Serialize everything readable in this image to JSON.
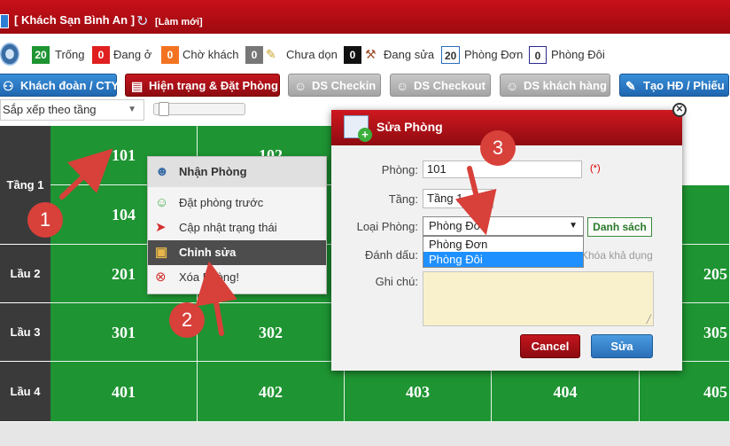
{
  "header": {
    "hotel_name": "[ Khách Sạn Bình An ]",
    "refresh_label": "[Làm mới]"
  },
  "status_counts": [
    {
      "count": "20",
      "label": "Trống",
      "color": "#1e9432",
      "text_color": "#ffffff"
    },
    {
      "count": "0",
      "label": "Đang ở",
      "color": "#e02020",
      "text_color": "#ffffff"
    },
    {
      "count": "0",
      "label": "Chờ khách",
      "color": "#f47321",
      "text_color": "#ffffff"
    },
    {
      "count": "0",
      "label": "Chưa dọn",
      "color": "#777777",
      "text_color": "#ffffff"
    },
    {
      "count": "0",
      "label": "Đang sửa",
      "color": "#111111",
      "text_color": "#ffffff"
    },
    {
      "count": "20",
      "label": "Phòng Đơn",
      "color": "#ffffff",
      "text_color": "#333333"
    },
    {
      "count": "0",
      "label": "Phòng Đôi",
      "color": "#ffffff",
      "text_color": "#333333"
    }
  ],
  "toolbar": {
    "group_booking": "Khách đoàn / CTY",
    "status_booking": "Hiện trạng & Đặt Phòng",
    "checkin_list": "DS Checkin",
    "checkout_list": "DS Checkout",
    "customer_list": "DS khách hàng",
    "create_invoice": "Tạo HĐ / Phiếu"
  },
  "sort": {
    "selected": "Sắp xếp theo tầng"
  },
  "floors": [
    {
      "name": "Tầng 1",
      "rooms": [
        "101",
        "102",
        "104"
      ]
    },
    {
      "name": "Lầu 2",
      "rooms": [
        "201",
        "205"
      ]
    },
    {
      "name": "Lầu 3",
      "rooms": [
        "301",
        "302",
        "305"
      ]
    },
    {
      "name": "Lầu 4",
      "rooms": [
        "401",
        "402",
        "403",
        "404",
        "405"
      ]
    }
  ],
  "context_menu": {
    "header": "Nhận Phòng",
    "items": [
      "Đặt phòng trước",
      "Cập nhật trạng thái",
      "Chỉnh sửa",
      "Xóa Phòng!"
    ]
  },
  "dialog": {
    "title": "Sửa Phòng",
    "room_label": "Phòng:",
    "room_value": "101",
    "required_mark": "(*)",
    "floor_label": "Tầng:",
    "floor_value": "Tầng 1",
    "type_label": "Loại Phòng:",
    "type_selected": "Phòng Đơn",
    "type_options": [
      "Phòng Đơn",
      "Phòng Đôi"
    ],
    "list_button": "Danh sách",
    "mark_label": "Đánh dấu:",
    "availability_note": "Khóa khả dụng",
    "note_label": "Ghi chú:",
    "cancel_button": "Cancel",
    "save_button": "Sửa"
  },
  "annotations": {
    "step1": "1",
    "step2": "2",
    "step3": "3",
    "color": "#d8403a"
  }
}
